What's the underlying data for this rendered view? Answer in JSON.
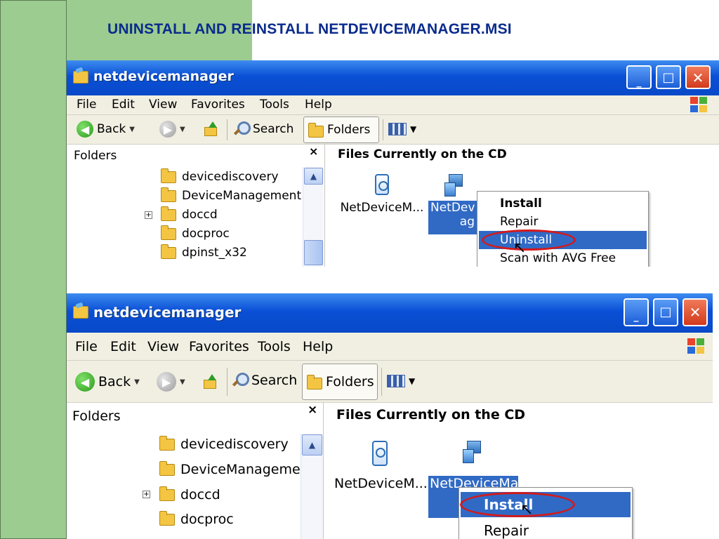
{
  "slide": {
    "title": "UNINSTALL AND REINSTALL NETDEVICEMANAGER.MSI"
  },
  "window": {
    "title": "netdevicemanager",
    "menu": [
      "File",
      "Edit",
      "View",
      "Favorites",
      "Tools",
      "Help"
    ],
    "toolbar": {
      "back_label": "Back",
      "search_label": "Search",
      "folders_label": "Folders"
    },
    "folders_pane": {
      "header": "Folders",
      "close_glyph": "×",
      "tree_items": [
        "devicediscovery",
        "DeviceManagement",
        "doccd",
        "docproc",
        "dpinst_x32"
      ]
    },
    "files_pane": {
      "header": "Files Currently on the CD",
      "file1_label": "NetDeviceM...",
      "file2_label_top": "NetDev",
      "file2_label_top_cont": "ag",
      "file2_label_bottom": "NetDeviceMan"
    }
  },
  "context_menu_top": {
    "items": [
      "Install",
      "Repair",
      "Uninstall",
      "Scan with AVG Free"
    ],
    "highlighted": "Uninstall"
  },
  "context_menu_bottom": {
    "items": [
      "Install",
      "Repair"
    ],
    "highlighted": "Install"
  },
  "colors": {
    "slide_green": "#9ccc90",
    "title_blue": "#0a2b8c",
    "xp_titlebar": "#0a4fd6",
    "selection_blue": "#316ac5",
    "annotation_red": "#d31a1a"
  }
}
